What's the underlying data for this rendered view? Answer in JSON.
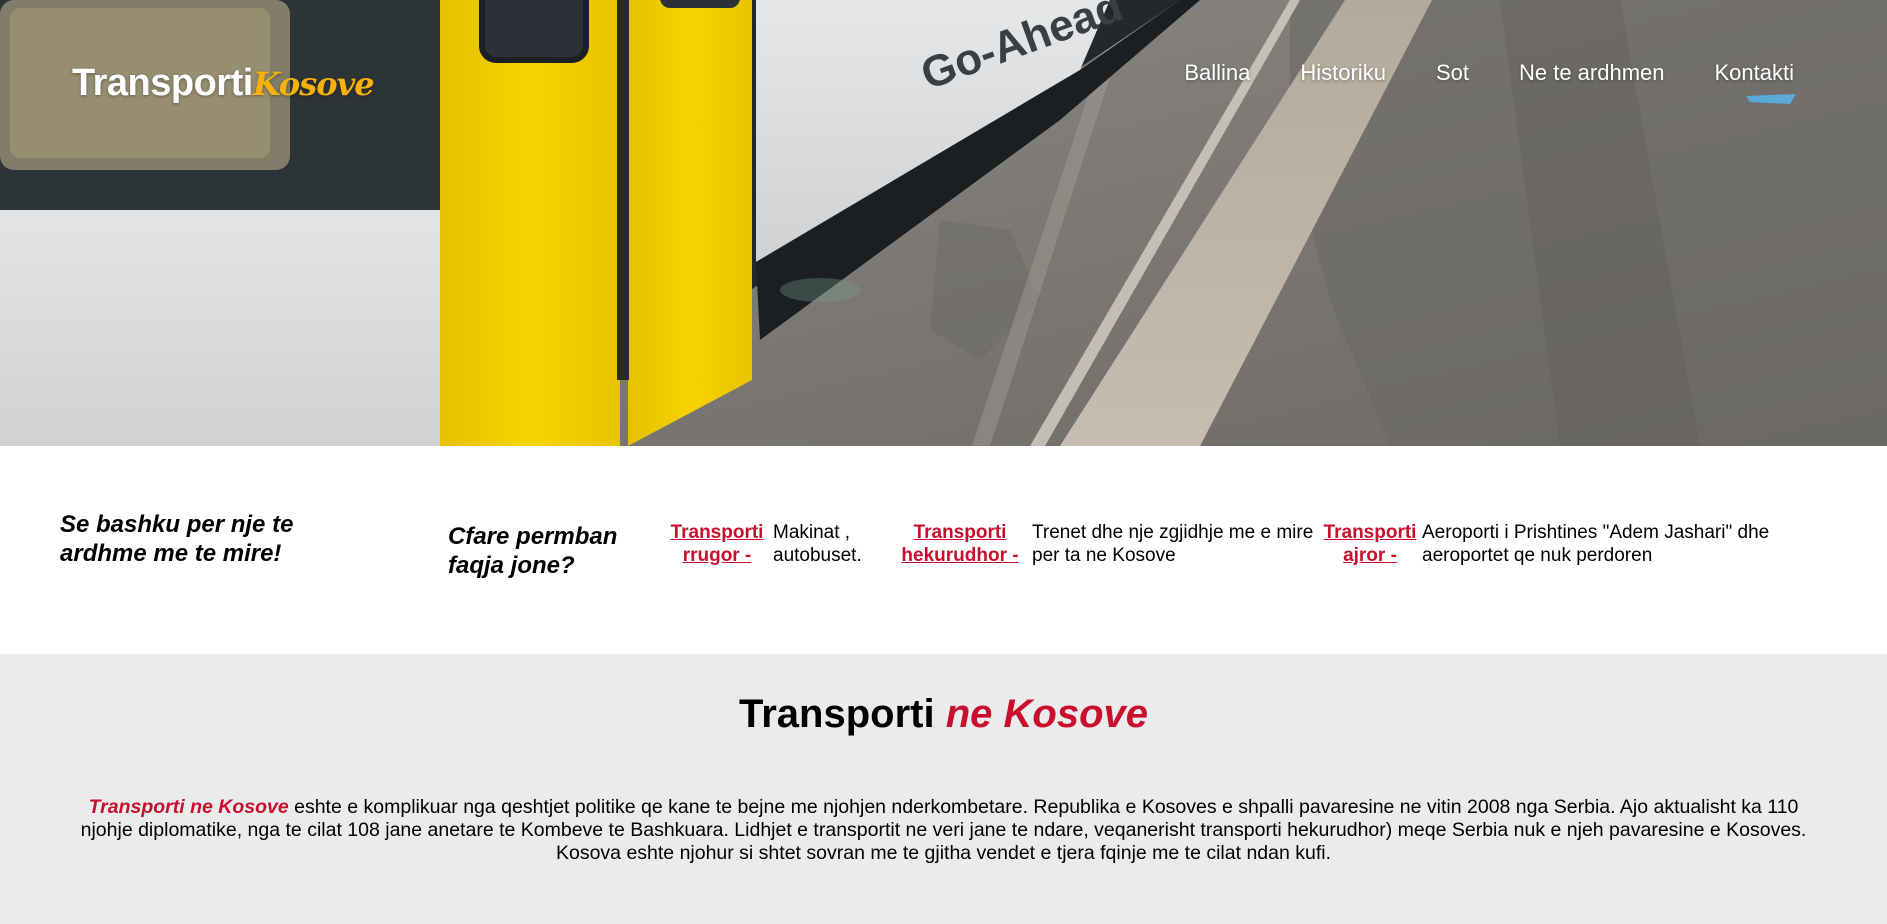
{
  "header": {
    "logo_main": "Transporti",
    "logo_accent": "Kosove",
    "train_brand": "Go-Ahead"
  },
  "nav": {
    "items": [
      {
        "label": "Ballina"
      },
      {
        "label": "Historiku"
      },
      {
        "label": "Sot"
      },
      {
        "label": "Ne te ardhmen"
      },
      {
        "label": "Kontakti"
      }
    ]
  },
  "strip": {
    "tagline": "Se bashku per nje te ardhme me te mire!",
    "question": "Cfare permban faqja jone?",
    "features": [
      {
        "link": "Transporti rrugor -",
        "desc": "Makinat , autobuset."
      },
      {
        "link": "Transporti hekurudhor -",
        "desc": "Trenet dhe nje zgjidhje me e mire per ta ne Kosove"
      },
      {
        "link": "Transporti ajror -",
        "desc": "Aeroporti i Prishtines \"Adem Jashari\" dhe aeroportet qe nuk perdoren"
      }
    ]
  },
  "about": {
    "title_main": "Transporti",
    "title_accent": "ne Kosove",
    "lead": "Transporti ne Kosove",
    "body": " eshte e komplikuar nga qeshtjet politike qe kane te bejne me njohjen nderkombetare. Republika e Kosoves e shpalli pavaresine ne vitin 2008 nga Serbia. Ajo aktualisht ka 110 njohje diplomatike, nga te cilat 108 jane anetare te Kombeve te Bashkuara. Lidhjet e transportit ne veri jane te ndare, veqanerisht transporti hekurudhor) meqe Serbia nuk e njeh pavaresine e Kosoves. Kosova eshte njohur si shtet sovran me te gjitha vendet e tjera fqinje me te cilat ndan kufi."
  },
  "colors": {
    "accent_red": "#c8102e",
    "logo_yellow": "#f6b10d",
    "section_gray": "#ebebeb",
    "train_yellow": "#f5d000"
  }
}
